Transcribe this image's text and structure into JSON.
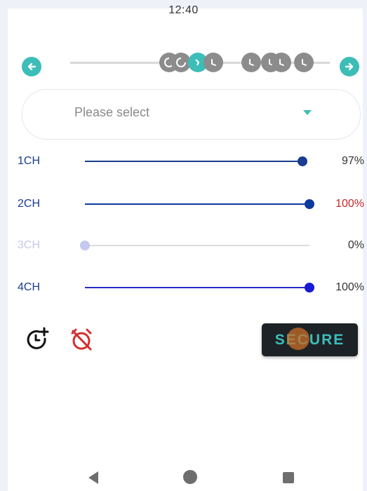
{
  "status_bar": {
    "time": "12:40"
  },
  "timeline": {
    "prev_icon": "arrow-left-icon",
    "next_icon": "arrow-right-icon",
    "node_icon": "clock-icon",
    "accent": "#3dbdb8"
  },
  "select": {
    "placeholder": "Please select"
  },
  "channels": [
    {
      "label": "1CH",
      "value": "97%",
      "level": 0.97,
      "label_color": "#1a3d8f",
      "value_color": "#333333",
      "track_color": "#1a3d8f",
      "thumb_color": "#1a3d8f"
    },
    {
      "label": "2CH",
      "value": "100%",
      "level": 1.0,
      "label_color": "#1a3d8f",
      "value_color": "#c62828",
      "track_color": "#0d3a9c",
      "thumb_color": "#0d3a9c"
    },
    {
      "label": "3CH",
      "value": "0%",
      "level": 0.0,
      "label_color": "#c5c8e6",
      "value_color": "#333333",
      "track_color": "#dcdcdc",
      "thumb_color": "#c5c8f0"
    },
    {
      "label": "4CH",
      "value": "100%",
      "level": 1.0,
      "label_color": "#1a3d8f",
      "value_color": "#333333",
      "track_color": "#2929c9",
      "thumb_color": "#1a1ad4"
    }
  ],
  "actions": {
    "add_timer_icon": "add-timer-icon",
    "alarm_off_icon": "alarm-off-icon",
    "secure_label": "SECURE"
  },
  "nav": {
    "back_icon": "back-triangle-icon",
    "home_icon": "home-circle-icon",
    "recents_icon": "recents-square-icon"
  }
}
